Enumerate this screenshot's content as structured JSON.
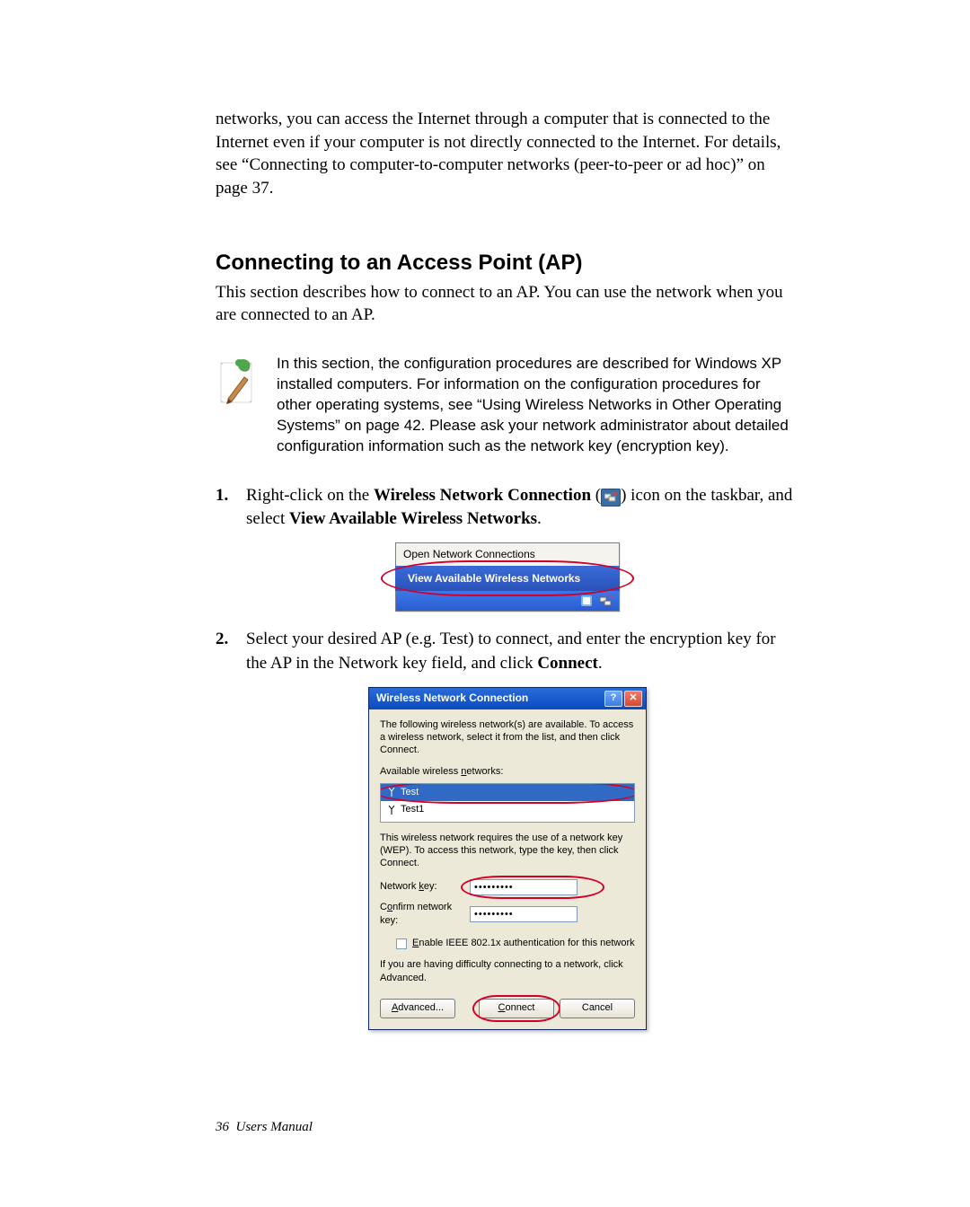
{
  "intro_paragraph": "networks, you can access the Internet through a computer that is connected to the Internet even if your computer is not directly connected to the Internet. For details, see “Connecting to computer-to-computer networks (peer-to-peer or ad hoc)” on page 37.",
  "heading": "Connecting to an Access Point (AP)",
  "section_intro": "This section describes how to connect to an AP. You can use the network when you are connected to an AP.",
  "note_text": "In this section, the configuration procedures are described for Windows XP installed computers. For information on the configuration procedures for other operating systems, see “Using Wireless Networks in Other Operating Systems” on page 42. Please ask your network administrator about detailed configuration information such as the network key (encryption key).",
  "step1": {
    "pre": "Right-click on the ",
    "bold1": "Wireless Network Connection",
    "between": " (",
    "after_icon": ") icon on the taskbar, and select ",
    "bold2": "View Available Wireless Networks",
    "end": "."
  },
  "step2": {
    "pre": "Select your desired AP (e.g. Test) to connect, and enter the encryption key for the AP in the Network key field, and click ",
    "bold": "Connect",
    "end": "."
  },
  "context_menu": {
    "item1": "Open Network Connections",
    "item2": "View Available Wireless Networks"
  },
  "dialog": {
    "title": "Wireless Network Connection",
    "desc": "The following wireless network(s) are available. To access a wireless network, select it from the list, and then click Connect.",
    "available_label_pre": "Available wireless ",
    "available_label_u": "n",
    "available_label_post": "etworks:",
    "networks": {
      "n0": "Test",
      "n1": "Test1"
    },
    "wep_text": "This wireless network requires the use of a network key (WEP). To access this network, type the key, then click Connect.",
    "netkey_label_pre": "Network ",
    "netkey_label_u": "k",
    "netkey_label_post": "ey:",
    "confirm_label_pre": "C",
    "confirm_label_u": "o",
    "confirm_label_post": "nfirm network key:",
    "key_value": "•••••••••",
    "enable_pre": "",
    "enable_u": "E",
    "enable_post": "nable IEEE 802.1x authentication for this network",
    "difficulty": "If you are having difficulty connecting to a network, click Advanced.",
    "btn_advanced_u": "A",
    "btn_advanced_post": "dvanced...",
    "btn_connect_u": "C",
    "btn_connect_post": "onnect",
    "btn_cancel": "Cancel"
  },
  "footer": {
    "page": "36",
    "label": "Users Manual"
  }
}
